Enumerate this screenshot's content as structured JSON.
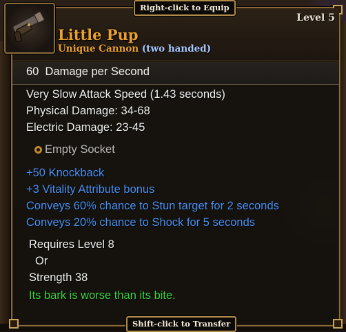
{
  "hints": {
    "top": "Right-click to Equip",
    "bottom": "Shift-click to Transfer"
  },
  "item": {
    "portrait_icon": "cannon-icon",
    "name": "Little Pup",
    "type": "Unique Cannon",
    "hands": "(two handed)",
    "level": "Level 5"
  },
  "dps": {
    "value": "60",
    "label": "Damage per Second"
  },
  "stats": [
    "Very Slow Attack Speed (1.43 seconds)",
    "Physical Damage: 34-68",
    "Electric Damage: 23-45"
  ],
  "socket": {
    "icon": "socket-ring-icon",
    "label": "Empty Socket"
  },
  "bonuses": [
    "+50 Knockback",
    "+3 Vitality Attribute bonus",
    "Conveys 60% chance to Stun target for 2 seconds",
    "Conveys 20% chance to Shock for 5 seconds"
  ],
  "requirements": {
    "level": "Requires Level 8",
    "or": "Or",
    "strength": "Strength 38"
  },
  "flavor": "Its bark is worse than its bite.",
  "colors": {
    "name": "#e8a030",
    "bonus": "#4a90f0",
    "flavor": "#3cd23c",
    "hands": "#a8c8ff"
  }
}
